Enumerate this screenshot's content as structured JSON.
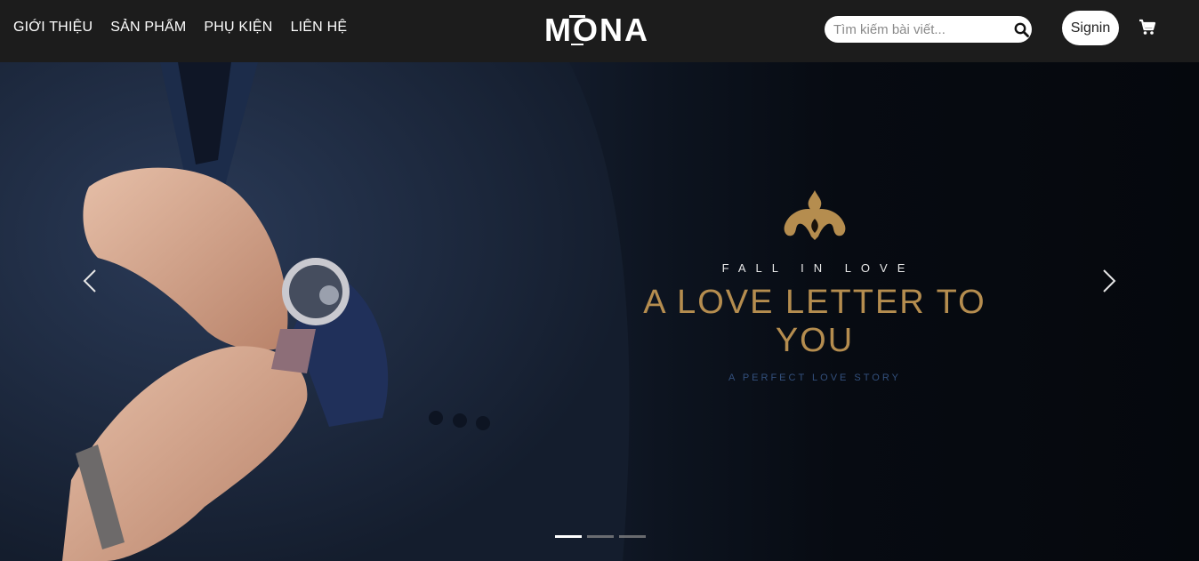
{
  "nav": {
    "links": [
      "GIỚI THIỆU",
      "SẢN PHẨM",
      "PHỤ KIỆN",
      "LIÊN HỆ"
    ],
    "logo": "MONA"
  },
  "search": {
    "placeholder": "Tìm kiếm bài viết...",
    "icon": "search-icon"
  },
  "signin_label": "Signin",
  "cart_icon": "cart-icon",
  "hero": {
    "small_text": "FALL IN LOVE",
    "title": "A LOVE LETTER TO YOU",
    "subtitle": "A PERFECT LOVE STORY",
    "prev_icon": "chevron-left-icon",
    "next_icon": "chevron-right-icon",
    "slide_count": 3,
    "active_slide": 1
  },
  "colors": {
    "navbar": "#1c1c1c",
    "gold": "#b58d4f",
    "subtitle_blue": "#33507d"
  }
}
